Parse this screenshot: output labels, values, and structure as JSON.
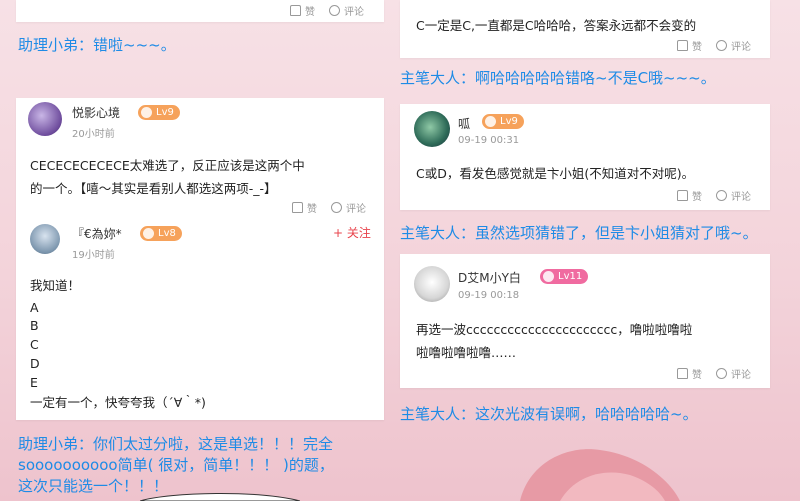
{
  "actions": {
    "like": "赞",
    "comment": "评论"
  },
  "left": {
    "top_reply": "助理小弟：错啦~~~。",
    "post1": {
      "user": "悦影心境",
      "level": "Lv9",
      "time": "20小时前",
      "text_line1": "CECECECECECE太难选了，反正应该是这两个中",
      "text_line2": "的一个。【嘻～其实是看别人都选这两项-_-】"
    },
    "post2": {
      "user": "『€為妳*",
      "level": "Lv8",
      "time": "19小时前",
      "follow": "+ 关注",
      "lines": [
        "我知道！",
        "A",
        "B",
        "C",
        "D",
        "E",
        "一定有一个，快夸夸我（´∀｀*)"
      ]
    },
    "bottom_reply": {
      "line1": "助理小弟：你们太过分啦，这是单选！！！完全",
      "line2": "soooooooooo简单( 很对，简单！！！ )的题，",
      "line3": "这次只能选一个！！！"
    }
  },
  "right": {
    "top_text": "C一定是C,一直都是C哈哈哈，答案永远都不会变的",
    "reply1": "主笔大人：啊哈哈哈哈哈错咯~不是C哦~~~。",
    "post1": {
      "user": "呱",
      "level": "Lv9",
      "time": "09-19 00:31",
      "text": "C或D，看发色感觉就是卞小姐(不知道对不对呢)。"
    },
    "reply2": "主笔大人：虽然选项猜错了，但是卞小姐猜对了哦~。",
    "post2": {
      "user": "D艾M小Y白",
      "level": "Lv11",
      "time": "09-19 00:18",
      "line1": "再选一波cccccccccccccccccccccc，噜啦啦噜啦",
      "line2": "啦噜啦噜啦噜……"
    },
    "reply3": "主笔大人：这次光波有误啊，哈哈哈哈哈~。"
  }
}
